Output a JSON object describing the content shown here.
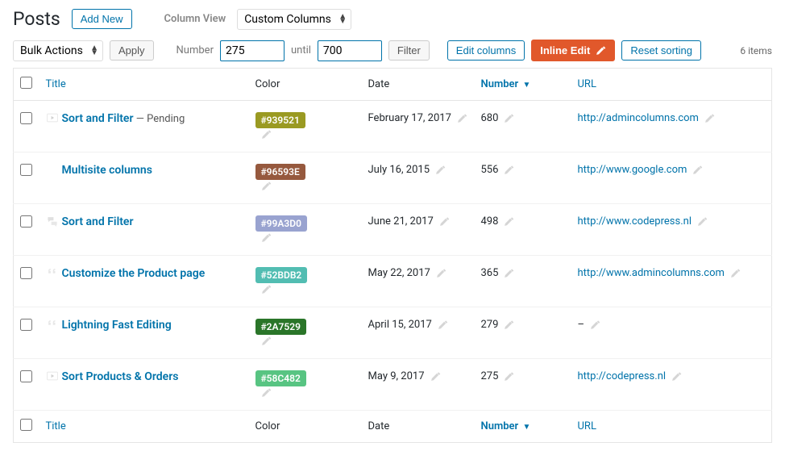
{
  "header": {
    "title": "Posts",
    "add_new": "Add New",
    "column_view_label": "Column View",
    "column_view_value": "Custom Columns"
  },
  "toolbar": {
    "bulk_actions_value": "Bulk Actions",
    "apply": "Apply",
    "number_label": "Number",
    "number_from": "275",
    "until_label": "until",
    "number_to": "700",
    "filter": "Filter",
    "edit_columns": "Edit columns",
    "inline_edit": "Inline Edit",
    "reset_sorting": "Reset sorting",
    "items_count": "6 items"
  },
  "columns": {
    "title": "Title",
    "color": "Color",
    "date": "Date",
    "number": "Number",
    "url": "URL",
    "sort_dir": "▼"
  },
  "rows": [
    {
      "title": "Sort and Filter",
      "status": " — Pending",
      "color_hex": "#939521",
      "color_bg": "#9a9a22",
      "date": "February 17, 2017",
      "number": "680",
      "url": "http://admincolumns.com",
      "icon": "video"
    },
    {
      "title": "Multisite columns",
      "status": "",
      "color_hex": "#96593E",
      "color_bg": "#96593e",
      "date": "July 16, 2015",
      "number": "556",
      "url": "http://www.google.com",
      "icon": ""
    },
    {
      "title": "Sort and Filter",
      "status": "",
      "color_hex": "#99A3D0",
      "color_bg": "#99a3d0",
      "date": "June 21, 2017",
      "number": "498",
      "url": "http://www.codepress.nl",
      "icon": "chat"
    },
    {
      "title": "Customize the Product page",
      "status": "",
      "color_hex": "#52BDB2",
      "color_bg": "#52bdb2",
      "date": "May 22, 2017",
      "number": "365",
      "url": "http://www.admincolumns.com",
      "icon": "quote"
    },
    {
      "title": "Lightning Fast Editing",
      "status": "",
      "color_hex": "#2A7529",
      "color_bg": "#2a7529",
      "date": "April 15, 2017",
      "number": "279",
      "url": "–",
      "icon": "quote"
    },
    {
      "title": "Sort Products & Orders",
      "status": "",
      "color_hex": "#58C482",
      "color_bg": "#58c482",
      "date": "May 9, 2017",
      "number": "275",
      "url": "http://codepress.nl",
      "icon": "video"
    }
  ]
}
